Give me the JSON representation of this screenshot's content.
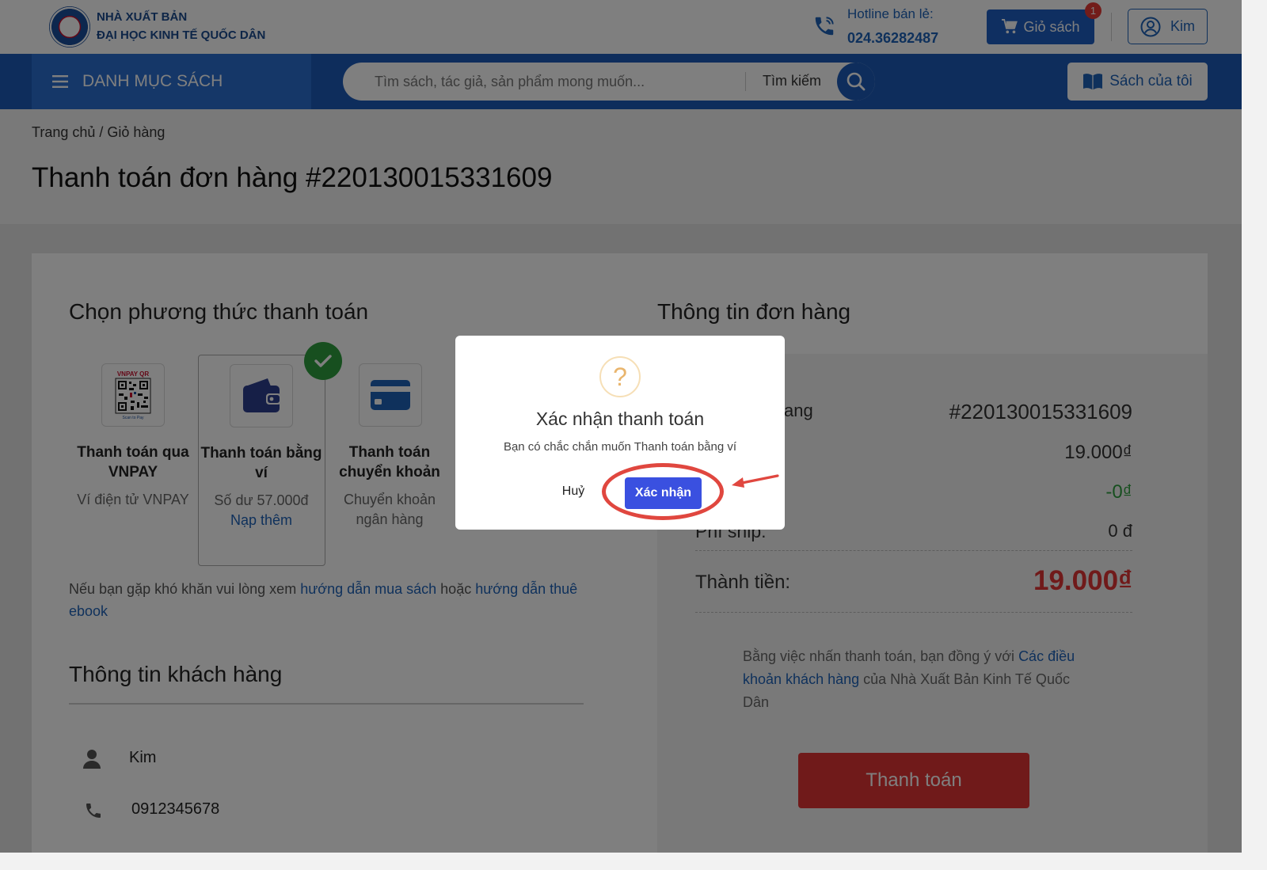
{
  "header": {
    "logo_line1": "NHÀ XUẤT BẢN",
    "logo_line2": "ĐẠI HỌC KINH TẾ QUỐC DÂN",
    "hotline_label": "Hotline bán lẻ:",
    "hotline_number": "024.36282487",
    "cart_label": "Giỏ sách",
    "cart_count": "1",
    "user_name": "Kim"
  },
  "nav": {
    "category_label": "DANH MỤC SÁCH",
    "search_placeholder": "Tìm sách, tác giả, sản phẩm mong muốn...",
    "search_label": "Tìm kiếm",
    "my_books_label": "Sách của tôi"
  },
  "breadcrumb": "Trang chủ / Giỏ hàng",
  "page_title": "Thanh toán đơn hàng #220130015331609",
  "payment": {
    "section_title": "Chọn phương thức thanh toán",
    "methods": [
      {
        "title": "Thanh toán qua VNPAY",
        "sub": "Ví điện tử VNPAY",
        "icon": "vnpay-qr-icon"
      },
      {
        "title": "Thanh toán bằng ví",
        "sub": "Số dư 57.000đ",
        "link": "Nạp thêm",
        "icon": "wallet-icon",
        "selected": true
      },
      {
        "title": "Thanh toán chuyển khoản",
        "sub": "Chuyển khoản ngân hàng",
        "icon": "credit-card-icon"
      }
    ],
    "help_prefix": "Nếu bạn gặp khó khăn vui lòng xem ",
    "help_link1": "hướng dẫn mua sách",
    "help_mid": " hoặc ",
    "help_link2": "hướng dẫn thuê ebook"
  },
  "customer": {
    "section_title": "Thông tin khách hàng",
    "name": "Kim",
    "phone": "0912345678"
  },
  "order": {
    "section_title": "Thông tin đơn hàng",
    "label_code_partial": "ang",
    "code": "#220130015331609",
    "subtotal": "19.000₫",
    "discount": "-0₫",
    "shipping_label_partial": "Phí ship:",
    "shipping": "0 đ",
    "total_label": "Thành tiền:",
    "total": "19.000₫",
    "terms_prefix": "Bằng việc nhấn thanh toán, bạn đồng ý với ",
    "terms_link": "Các điều khoản khách hàng",
    "terms_suffix": " của Nhà Xuất Bản Kinh Tế Quốc Dân",
    "pay_button": "Thanh toán"
  },
  "modal": {
    "icon": "question-icon",
    "title": "Xác nhận thanh toán",
    "message": "Bạn có chắc chắn muốn Thanh toán bằng ví",
    "cancel_label": "Huỷ",
    "confirm_label": "Xác nhận"
  },
  "colors": {
    "primary": "#1c5ab8",
    "accent_red": "#e03535",
    "success": "#2e9e3e",
    "confirm": "#3a50e0",
    "annotation": "#e0473f"
  }
}
